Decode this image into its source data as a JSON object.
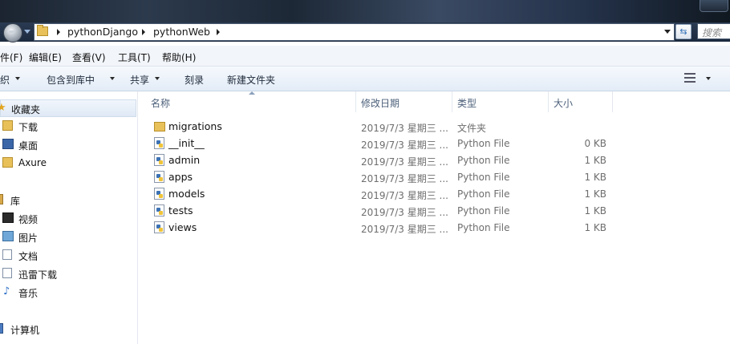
{
  "address": {
    "crumbs": [
      "pythonDjango",
      "pythonWeb"
    ],
    "search_placeholder": "搜索"
  },
  "menu": {
    "items": [
      "件(F)",
      "编辑(E)",
      "查看(V)",
      "工具(T)",
      "帮助(H)"
    ]
  },
  "toolbar": {
    "organize": "织",
    "include": "包含到库中",
    "share": "共享",
    "burn": "刻录",
    "new_folder": "新建文件夹"
  },
  "nav": {
    "favorites": "收藏夹",
    "downloads": "下载",
    "desktop": "桌面",
    "axure": "Axure",
    "library": "库",
    "video": "视频",
    "pictures": "图片",
    "documents": "文档",
    "xunlei": "迅雷下载",
    "music": "音乐",
    "computer": "计算机"
  },
  "columns": {
    "name": "名称",
    "date": "修改日期",
    "type": "类型",
    "size": "大小"
  },
  "files": [
    {
      "name": "migrations",
      "date": "2019/7/3 星期三 ...",
      "type": "文件夹",
      "size": "",
      "icon": "folder-icon"
    },
    {
      "name": "__init__",
      "date": "2019/7/3 星期三 ...",
      "type": "Python File",
      "size": "0 KB",
      "icon": "python-file-icon"
    },
    {
      "name": "admin",
      "date": "2019/7/3 星期三 ...",
      "type": "Python File",
      "size": "1 KB",
      "icon": "python-file-icon"
    },
    {
      "name": "apps",
      "date": "2019/7/3 星期三 ...",
      "type": "Python File",
      "size": "1 KB",
      "icon": "python-file-icon"
    },
    {
      "name": "models",
      "date": "2019/7/3 星期三 ...",
      "type": "Python File",
      "size": "1 KB",
      "icon": "python-file-icon"
    },
    {
      "name": "tests",
      "date": "2019/7/3 星期三 ...",
      "type": "Python File",
      "size": "1 KB",
      "icon": "python-file-icon"
    },
    {
      "name": "views",
      "date": "2019/7/3 星期三 ...",
      "type": "Python File",
      "size": "1 KB",
      "icon": "python-file-icon"
    }
  ],
  "colors": {
    "folder": "#e8c15a",
    "header_text": "#4c607a",
    "detail_text": "#6e6e6e"
  }
}
